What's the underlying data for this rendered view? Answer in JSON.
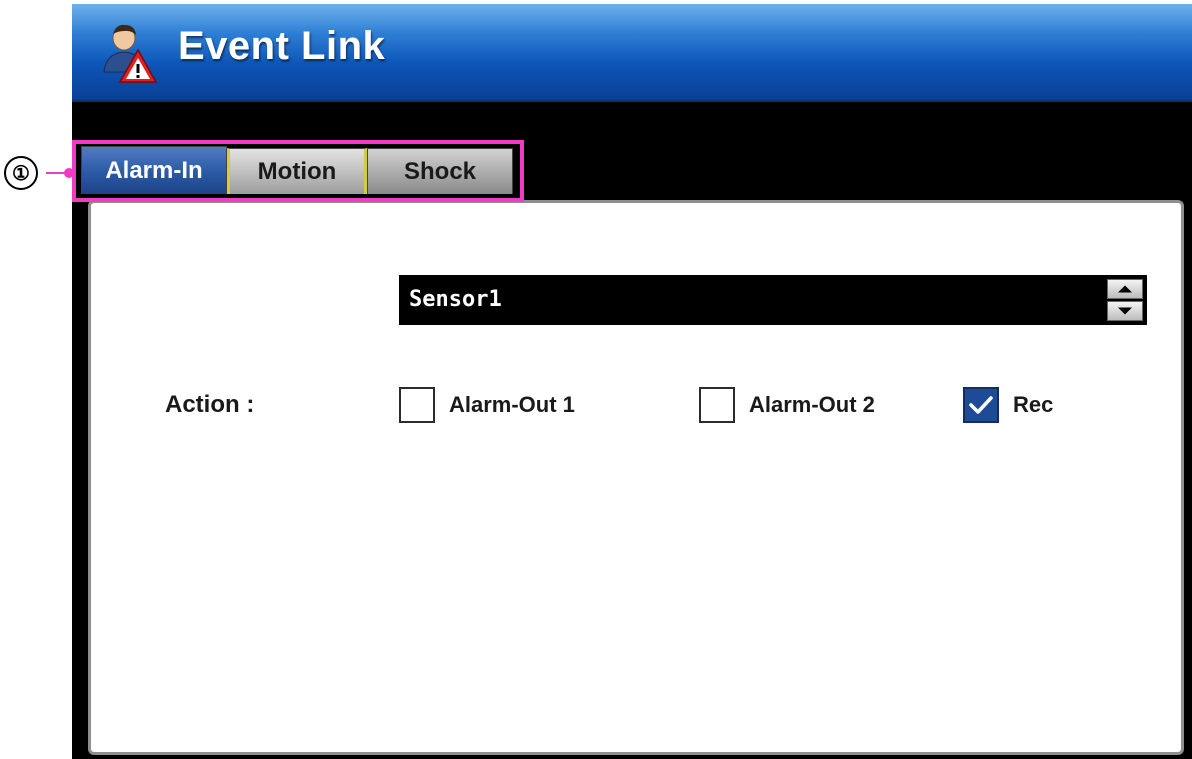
{
  "window": {
    "title": "Event Link"
  },
  "tabs": [
    {
      "label": "Alarm-In",
      "active": true
    },
    {
      "label": "Motion",
      "active": false
    },
    {
      "label": "Shock",
      "active": false
    }
  ],
  "annotation": {
    "number": "①",
    "color": "#f03cc4"
  },
  "sensor": {
    "value": "Sensor1"
  },
  "actions": {
    "label": "Action :",
    "options": [
      {
        "label": "Alarm-Out 1",
        "checked": false
      },
      {
        "label": "Alarm-Out 2",
        "checked": false
      },
      {
        "label": "Rec",
        "checked": true
      }
    ]
  },
  "icons": {
    "title": "user-alarm-icon",
    "check": "checkmark-icon",
    "spin_up": "arrow-up-icon",
    "spin_down": "arrow-down-icon"
  },
  "colors": {
    "titlebar": "#0d56b8",
    "active_tab": "#2a5aa4",
    "checked_box": "#1d4b97",
    "highlight": "#f03cc4"
  }
}
